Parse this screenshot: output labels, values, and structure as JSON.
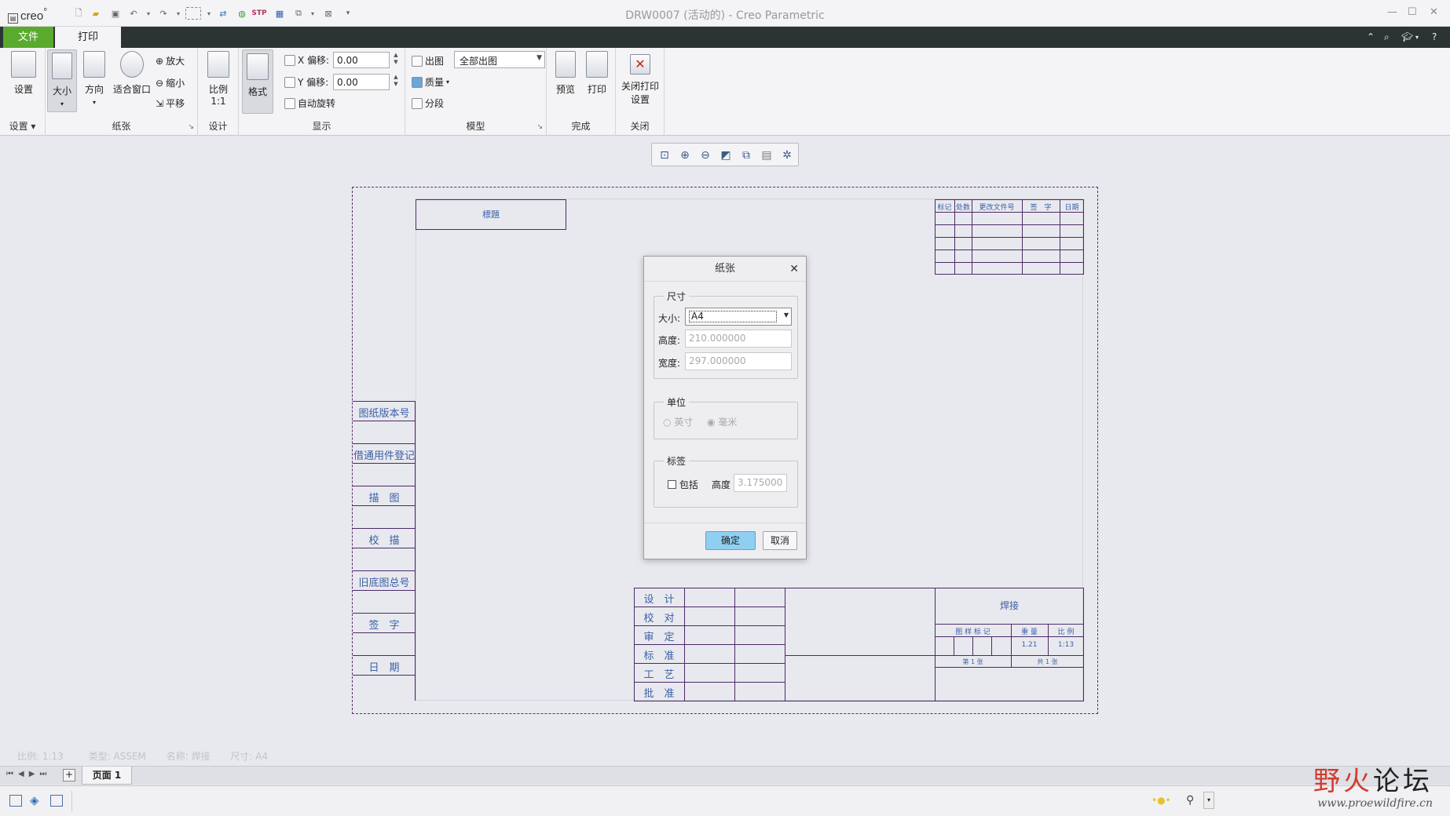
{
  "window": {
    "logo": "creo",
    "title": "DRW0007 (活动的) - Creo Parametric",
    "controls": [
      "—",
      "☐",
      "✕"
    ]
  },
  "tabs": {
    "file": "文件",
    "print": "打印"
  },
  "ribbon": {
    "settings": {
      "button": "设置",
      "group": "设置"
    },
    "paper": {
      "size": "大小",
      "orientation": "方向",
      "fit_window": "适合窗口",
      "zoom_in": "放大",
      "zoom_out": "缩小",
      "pan": "平移",
      "group": "纸张"
    },
    "design": {
      "scale_label": "比例",
      "scale_value": "1:1",
      "group": "设计"
    },
    "display": {
      "format": "格式",
      "x_offset_label": "X 偏移:",
      "x_offset_value": "0.00",
      "y_offset_label": "Y 偏移:",
      "y_offset_value": "0.00",
      "auto_rotate": "自动旋转",
      "group": "显示"
    },
    "model": {
      "plot": "出图",
      "plot_combo": "全部出图",
      "quality": "质量",
      "segment": "分段",
      "group": "模型"
    },
    "finish": {
      "preview": "预览",
      "print": "打印",
      "group": "完成"
    },
    "close": {
      "close_line1": "关闭打印",
      "close_line2": "设置",
      "group": "关闭"
    }
  },
  "drawing": {
    "top_box": "標題",
    "left_labels": [
      "图纸版本号",
      "借通用件登记",
      "描　图",
      "校　描",
      "旧底图总号",
      "签　字",
      "日　期"
    ],
    "revision_headers": [
      "标记",
      "处数",
      "更改文件号",
      "签　字",
      "日期"
    ],
    "approval_rows": [
      "设　计",
      "校　对",
      "审　定",
      "标　准",
      "工　艺",
      "批　准"
    ],
    "title_name": "焊接",
    "title_sub_headers": [
      "图 样 标 记",
      "重 量",
      "比 例"
    ],
    "weight": "1.21",
    "scale": "1:13",
    "sheet_of": [
      "第 1 张",
      "共 1 张"
    ]
  },
  "dialog": {
    "title": "纸张",
    "size_group": "尺寸",
    "size_label": "大小:",
    "size_value": "A4",
    "height_label": "高度:",
    "height_value": "210.000000",
    "width_label": "宽度:",
    "width_value": "297.000000",
    "unit_group": "单位",
    "unit_inch": "英寸",
    "unit_mm": "毫米",
    "label_group": "标签",
    "include": "包括",
    "label_height_label": "高度",
    "label_height_value": "3.175000",
    "ok": "确定",
    "cancel": "取消"
  },
  "status": {
    "scale": "比例: 1:13",
    "type": "类型: ASSEM",
    "name": "名称: 焊接",
    "size": "尺寸: A4"
  },
  "pagebar": {
    "page": "页面 1",
    "add": "+"
  },
  "watermark": {
    "text_red": "野火",
    "text_black": "论坛",
    "url": "www.proewildfire.cn"
  },
  "colors": {
    "file_tab": "#5aaa2f",
    "tab_bar": "#2c3433",
    "ok_button": "#8fd0f2",
    "drawing_lines": "#4b2a66",
    "drawing_text": "#3a5fa8"
  }
}
